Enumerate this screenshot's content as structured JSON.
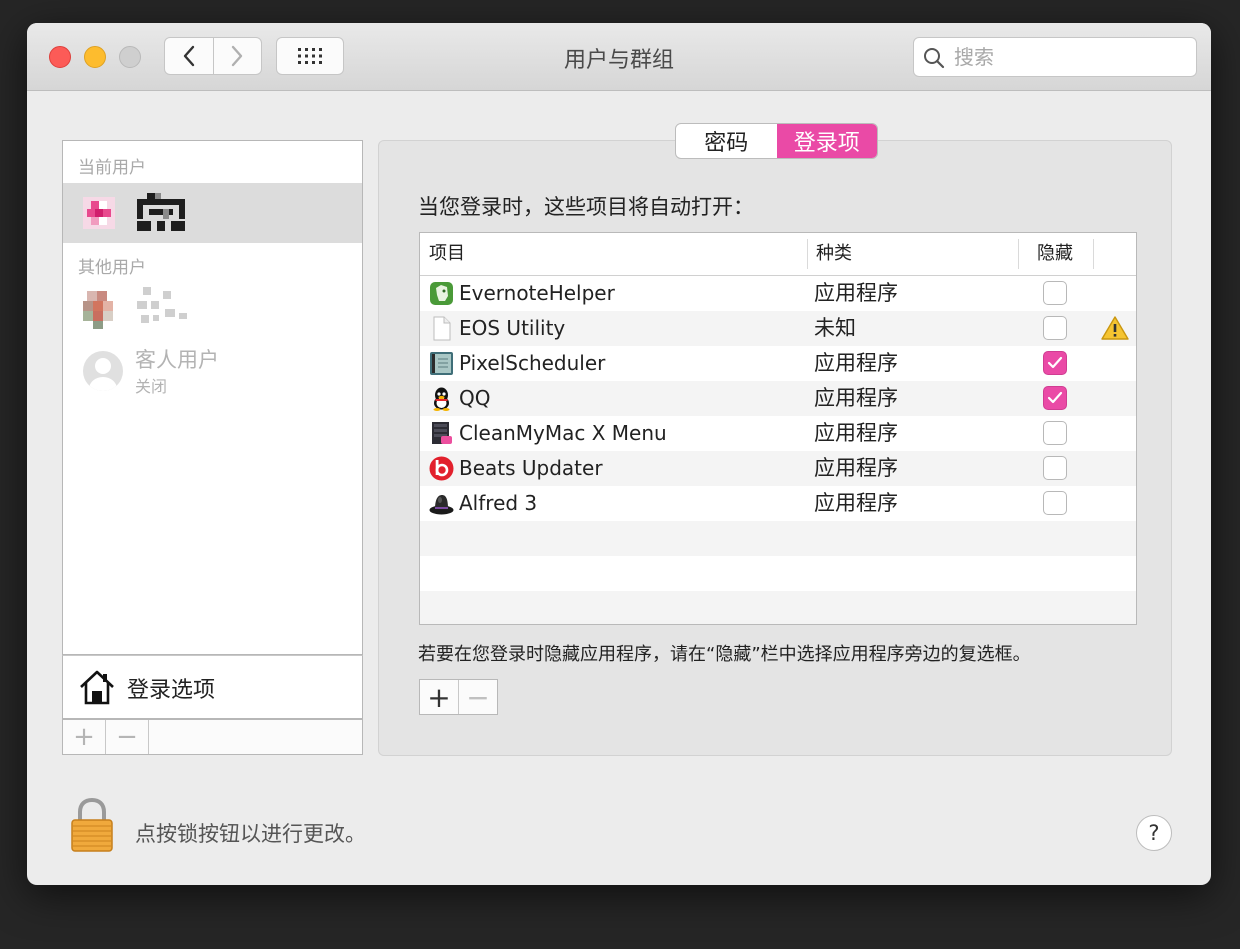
{
  "window": {
    "title": "用户与群组"
  },
  "search": {
    "placeholder": "搜索"
  },
  "sidebar": {
    "current_user_label": "当前用户",
    "other_users_label": "其他用户",
    "guest": {
      "name": "客人用户",
      "status": "关闭"
    },
    "login_options_label": "登录选项",
    "add_label": "+",
    "remove_label": "−"
  },
  "tabs": [
    {
      "label": "密码",
      "active": false
    },
    {
      "label": "登录项",
      "active": true
    }
  ],
  "login_items": {
    "intro": "当您登录时，这些项目将自动打开：",
    "columns": {
      "item": "项目",
      "kind": "种类",
      "hide": "隐藏"
    },
    "rows": [
      {
        "name": "EvernoteHelper",
        "kind": "应用程序",
        "hidden": false,
        "warning": false,
        "icon": "evernote-icon"
      },
      {
        "name": "EOS Utility",
        "kind": "未知",
        "hidden": false,
        "warning": true,
        "icon": "document-icon"
      },
      {
        "name": "PixelScheduler",
        "kind": "应用程序",
        "hidden": true,
        "warning": false,
        "icon": "pixelscheduler-icon"
      },
      {
        "name": "QQ",
        "kind": "应用程序",
        "hidden": true,
        "warning": false,
        "icon": "qq-penguin-icon"
      },
      {
        "name": "CleanMyMac X Menu",
        "kind": "应用程序",
        "hidden": false,
        "warning": false,
        "icon": "cleanmymac-icon"
      },
      {
        "name": "Beats Updater",
        "kind": "应用程序",
        "hidden": false,
        "warning": false,
        "icon": "beats-icon"
      },
      {
        "name": "Alfred 3",
        "kind": "应用程序",
        "hidden": false,
        "warning": false,
        "icon": "alfred-hat-icon"
      }
    ],
    "hint": "若要在您登录时隐藏应用程序，请在“隐藏”栏中选择应用程序旁边的复选框。",
    "add_label": "+",
    "remove_label": "−"
  },
  "footer": {
    "lock_text": "点按锁按钮以进行更改。",
    "help_label": "?"
  },
  "colors": {
    "accent": "#ea4aa6",
    "close": "#fc5b57",
    "minimize": "#fdbc2e"
  }
}
